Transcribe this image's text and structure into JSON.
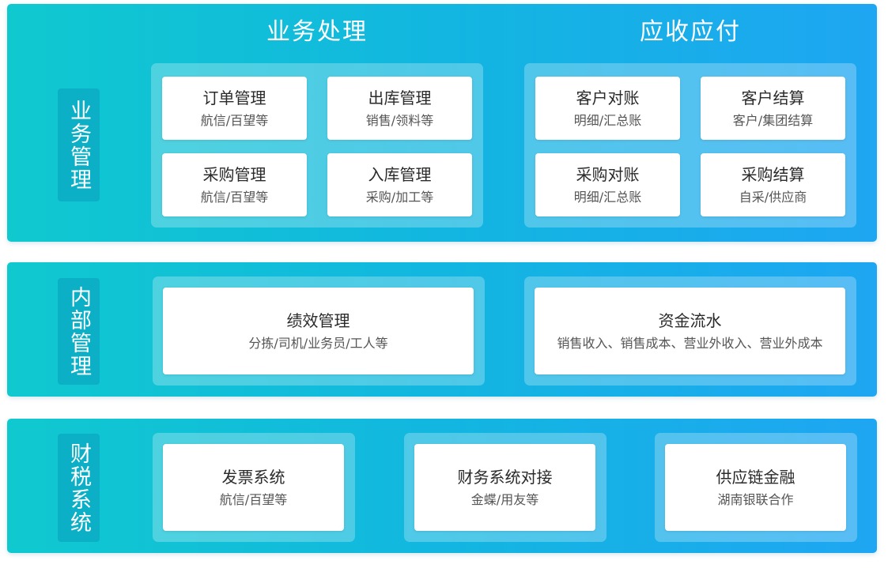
{
  "panel1": {
    "side_label": "业务管理",
    "title_left": "业务处理",
    "title_right": "应收应付",
    "cards": [
      {
        "title": "订单管理",
        "subtitle": "航信/百望等"
      },
      {
        "title": "出库管理",
        "subtitle": "销售/领料等"
      },
      {
        "title": "采购管理",
        "subtitle": "航信/百望等"
      },
      {
        "title": "入库管理",
        "subtitle": "采购/加工等"
      },
      {
        "title": "客户对账",
        "subtitle": "明细/汇总账"
      },
      {
        "title": "客户结算",
        "subtitle": "客户/集团结算"
      },
      {
        "title": "采购对账",
        "subtitle": "明细/汇总账"
      },
      {
        "title": "采购结算",
        "subtitle": "自采/供应商"
      }
    ]
  },
  "panel2": {
    "side_label": "内部管理",
    "cards": [
      {
        "title": "绩效管理",
        "subtitle": "分拣/司机/业务员/工人等"
      },
      {
        "title": "资金流水",
        "subtitle": "销售收入、销售成本、营业外收入、营业外成本"
      }
    ]
  },
  "panel3": {
    "side_label": "财税系统",
    "cards": [
      {
        "title": "发票系统",
        "subtitle": "航信/百望等"
      },
      {
        "title": "财务系统对接",
        "subtitle": "金蝶/用友等"
      },
      {
        "title": "供应链金融",
        "subtitle": "湖南银联合作"
      }
    ]
  }
}
